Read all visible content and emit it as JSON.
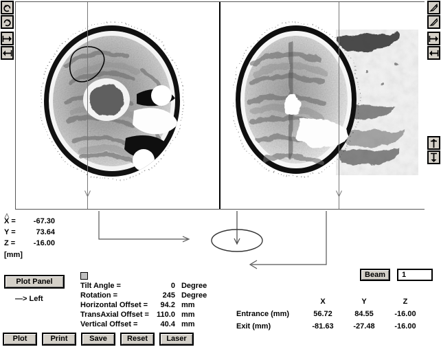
{
  "toolbars": {
    "left": [
      {
        "name": "rotate-ccw-icon",
        "tip": "Rotate counter-clockwise"
      },
      {
        "name": "rotate-cw-icon",
        "tip": "Rotate clockwise"
      },
      {
        "name": "arrow-right-icon",
        "tip": "Shift right"
      },
      {
        "name": "arrow-left-icon",
        "tip": "Shift left"
      }
    ],
    "right": [
      {
        "name": "diagonal-up-icon",
        "tip": "Tilt up"
      },
      {
        "name": "diagonal-down-icon",
        "tip": "Tilt down"
      },
      {
        "name": "arrow-right-icon",
        "tip": "Shift right"
      },
      {
        "name": "arrow-left-icon",
        "tip": "Shift left"
      },
      {
        "name": "arrow-up-icon",
        "tip": "Shift up"
      },
      {
        "name": "arrow-down-icon",
        "tip": "Shift down"
      }
    ]
  },
  "viewer": {
    "pane_left_name": "transverse-slice",
    "pane_right_name": "sagittal-slice"
  },
  "coordinates": {
    "x_label": "X =",
    "x_value": "-67.30",
    "y_label": "Y =",
    "y_value": "73.64",
    "z_label": "Z =",
    "z_value": "-16.00",
    "unit": "[mm]"
  },
  "controls": {
    "plot_panel_label": "Plot Panel",
    "direction_label": "—> Left",
    "actions": [
      {
        "label": "Plot",
        "name": "plot-button"
      },
      {
        "label": "Print",
        "name": "print-button"
      },
      {
        "label": "Save",
        "name": "save-button"
      },
      {
        "label": "Reset",
        "name": "reset-button"
      },
      {
        "label": "Laser",
        "name": "laser-button"
      }
    ]
  },
  "parameters": [
    {
      "name": "Tilt Angle =",
      "value": "0",
      "unit": "Degree"
    },
    {
      "name": "Rotation =",
      "value": "245",
      "unit": "Degree"
    },
    {
      "name": "Horizontal Offset =",
      "value": "94.2",
      "unit": "mm"
    },
    {
      "name": "TransAxial Offset =",
      "value": "110.0",
      "unit": "mm"
    },
    {
      "name": "Vertical Offset =",
      "value": "40.4",
      "unit": "mm"
    }
  ],
  "beam": {
    "button_label": "Beam",
    "number": "1"
  },
  "beam_table": {
    "headers": [
      "",
      "X",
      "Y",
      "Z"
    ],
    "rows": [
      {
        "label": "Entrance (mm)",
        "x": "56.72",
        "y": "84.55",
        "z": "-16.00"
      },
      {
        "label": "Exit (mm)",
        "x": "-81.63",
        "y": "-27.48",
        "z": "-16.00"
      }
    ]
  }
}
